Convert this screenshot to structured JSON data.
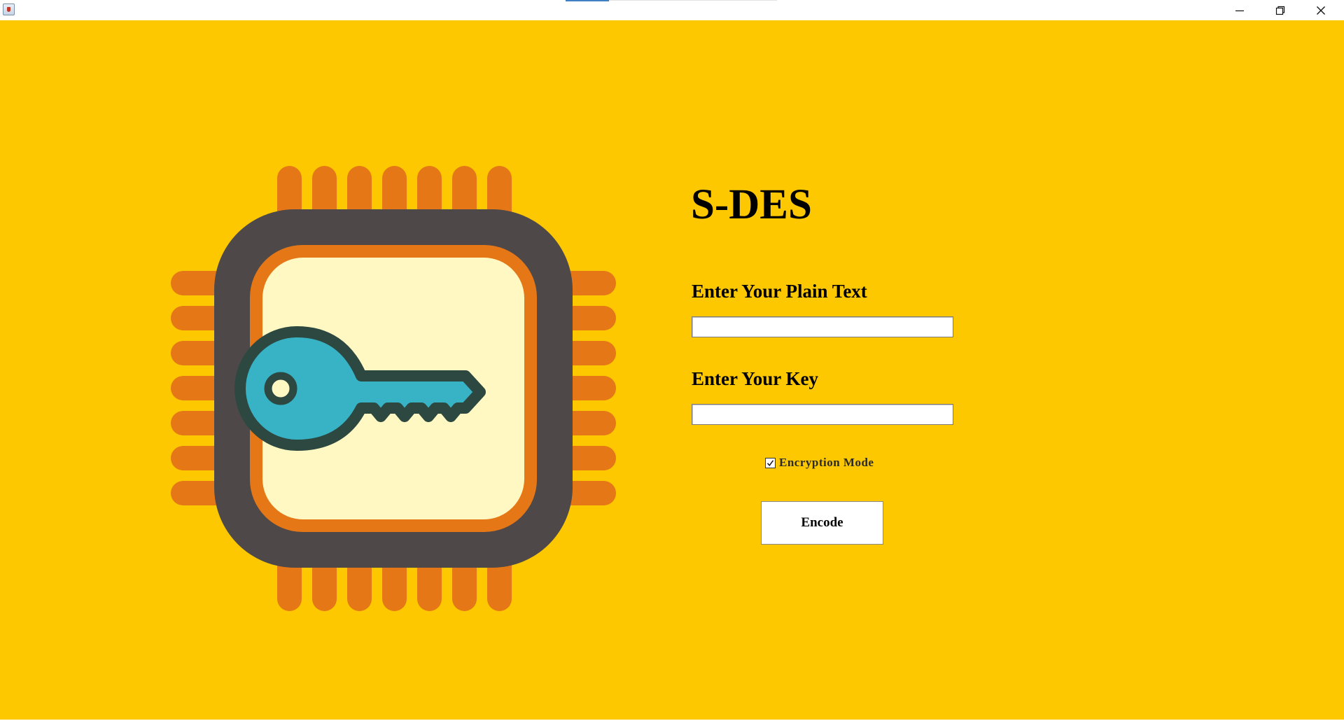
{
  "window": {
    "title": "",
    "controls": {
      "minimize_icon": "minimize-icon",
      "restore_icon": "restore-icon",
      "close_icon": "close-icon"
    }
  },
  "colors": {
    "background": "#fdc800",
    "chip_pins": "#e67717",
    "chip_body": "#4e4848",
    "chip_ring": "#e67717",
    "chip_core": "#fff8c2",
    "key_fill": "#38b3c6",
    "key_outline": "#2c4840"
  },
  "illustration": {
    "icon": "chip-key-icon"
  },
  "main": {
    "title": "S-DES",
    "plain_text": {
      "label": "Enter Your Plain Text",
      "value": "",
      "placeholder": ""
    },
    "key": {
      "label": "Enter Your Key",
      "value": "",
      "placeholder": ""
    },
    "mode": {
      "label": "Encryption Mode",
      "checked": true
    },
    "encode_button": {
      "label": "Encode"
    }
  }
}
